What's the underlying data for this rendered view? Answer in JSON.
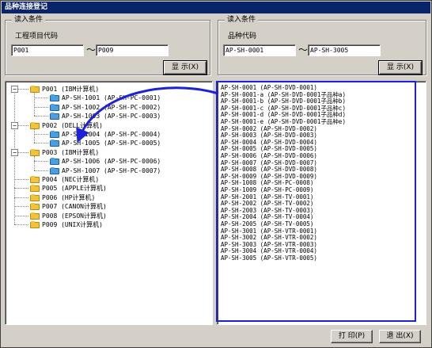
{
  "window": {
    "title": "品种连接登记"
  },
  "left_group": {
    "title": "读入条件",
    "label": "工程项目代码",
    "from_value": "P001",
    "to_value": "P009",
    "separator": "～",
    "show_button": "显 示(X)"
  },
  "right_group": {
    "title": "读入条件",
    "label": "品种代码",
    "from_value": "AP-SH-0001",
    "to_value": "AP-SH-3005",
    "separator": "～",
    "show_button": "显 示(X)"
  },
  "tree": [
    {
      "code": "P001",
      "name": "(IBM计算机)",
      "expanded": true,
      "children": [
        {
          "code": "AP-SH-1001",
          "ref": "(AP-SH-PC-0001)"
        },
        {
          "code": "AP-SH-1002",
          "ref": "(AP-SH-PC-0002)"
        },
        {
          "code": "AP-SH-1003",
          "ref": "(AP-SH-PC-0003)"
        }
      ]
    },
    {
      "code": "P002",
      "name": "(DELL计算机)",
      "expanded": true,
      "children": [
        {
          "code": "AP-SH-1004",
          "ref": "(AP-SH-PC-0004)"
        },
        {
          "code": "AP-SH-1005",
          "ref": "(AP-SH-PC-0005)"
        }
      ]
    },
    {
      "code": "P003",
      "name": "(IBM计算机)",
      "expanded": true,
      "children": [
        {
          "code": "AP-SH-1006",
          "ref": "(AP-SH-PC-0006)"
        },
        {
          "code": "AP-SH-1007",
          "ref": "(AP-SH-PC-0007)"
        }
      ]
    },
    {
      "code": "P004",
      "name": "(NEC计算机)",
      "expanded": false,
      "children": []
    },
    {
      "code": "P005",
      "name": "(APPLE计算机)",
      "expanded": false,
      "children": []
    },
    {
      "code": "P006",
      "name": "(HP计算机)",
      "expanded": false,
      "children": []
    },
    {
      "code": "P007",
      "name": "(CANON计算机)",
      "expanded": false,
      "children": []
    },
    {
      "code": "P008",
      "name": "(EPSON计算机)",
      "expanded": false,
      "children": []
    },
    {
      "code": "P009",
      "name": "(UNIX计算机)",
      "expanded": false,
      "children": []
    }
  ],
  "list": [
    "AP-SH-0001   (AP-SH-DVD-0001)",
    "AP-SH-0001-a   (AP-SH-DVD-0001子品种a)",
    "AP-SH-0001-b   (AP-SH-DVD-0001子品种b)",
    "AP-SH-0001-c   (AP-SH-DVD-0001子品种c)",
    "AP-SH-0001-d   (AP-SH-DVD-0001子品种d)",
    "AP-SH-0001-e   (AP-SH-DVD-0001子品种e)",
    "AP-SH-0002   (AP-SH-DVD-0002)",
    "AP-SH-0003   (AP-SH-DVD-0003)",
    "AP-SH-0004   (AP-SH-DVD-0004)",
    "AP-SH-0005   (AP-SH-DVD-0005)",
    "AP-SH-0006   (AP-SH-DVD-0006)",
    "AP-SH-0007   (AP-SH-DVD-0007)",
    "AP-SH-0008   (AP-SH-DVD-0008)",
    "AP-SH-0009   (AP-SH-DVD-0009)",
    "AP-SH-1008   (AP-SH-PC-0008)",
    "AP-SH-1009   (AP-SH-PC-0009)",
    "AP-SH-2001   (AP-SH-TV-0001)",
    "AP-SH-2002   (AP-SH-TV-0002)",
    "AP-SH-2003   (AP-SH-TV-0003)",
    "AP-SH-2004   (AP-SH-TV-0004)",
    "AP-SH-2005   (AP-SH-TV-0005)",
    "AP-SH-3001   (AP-SH-VTR-0001)",
    "AP-SH-3002   (AP-SH-VTR-0002)",
    "AP-SH-3003   (AP-SH-VTR-0003)",
    "AP-SH-3004   (AP-SH-VTR-0004)",
    "AP-SH-3005   (AP-SH-VTR-0005)"
  ],
  "buttons": {
    "print": "打 印(P)",
    "exit": "退 出(X)"
  },
  "colors": {
    "title_bar": "#0a246a",
    "highlight": "#1d22d8",
    "folder_yellow": "#f2c23a",
    "folder_blue": "#4a9fe0"
  },
  "icons": {
    "folder_parent": "folder-icon",
    "folder_child": "folder-icon",
    "expander": "tree-expander-icon",
    "annotation": "arrow-icon"
  }
}
